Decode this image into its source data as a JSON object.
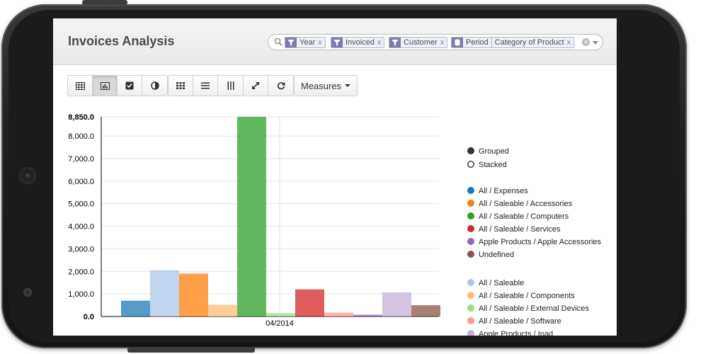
{
  "page": {
    "title": "Invoices Analysis"
  },
  "search": {
    "facets": [
      {
        "type": "filter",
        "label": "Year"
      },
      {
        "type": "filter",
        "label": "Invoiced"
      },
      {
        "type": "filter",
        "label": "Customer"
      },
      {
        "type": "groupby",
        "label": "Period",
        "value": "Category of Product"
      }
    ],
    "remove_label": "x"
  },
  "toolbar": {
    "measures_label": "Measures",
    "active_view": "chart"
  },
  "chart_data": {
    "type": "bar",
    "mode": "Grouped",
    "categories": [
      "04/2014"
    ],
    "ylim": [
      0,
      8850
    ],
    "y_ticks": [
      "0.0",
      "1,000.0",
      "2,000.0",
      "3,000.0",
      "4,000.0",
      "5,000.0",
      "6,000.0",
      "7,000.0",
      "8,000.0",
      "8,850.0"
    ],
    "y_tick_values": [
      0,
      1000,
      2000,
      3000,
      4000,
      5000,
      6000,
      7000,
      8000,
      8850
    ],
    "grid": true,
    "legend_position": "right",
    "mode_options": [
      {
        "label": "Grouped",
        "selected": true
      },
      {
        "label": "Stacked",
        "selected": false
      }
    ],
    "series": [
      {
        "name": "All / Expenses",
        "color": "#1f77b4",
        "values": [
          700
        ]
      },
      {
        "name": "All / Saleable",
        "color": "#aec7e8",
        "values": [
          2050
        ]
      },
      {
        "name": "All / Saleable / Accessories",
        "color": "#ff7f0e",
        "values": [
          1900
        ]
      },
      {
        "name": "All / Saleable / Components",
        "color": "#ffbb78",
        "values": [
          520
        ]
      },
      {
        "name": "All / Saleable / Computers",
        "color": "#2ca02c",
        "values": [
          8850
        ]
      },
      {
        "name": "All / Saleable / External Devices",
        "color": "#98df8a",
        "values": [
          150
        ]
      },
      {
        "name": "All / Saleable / Services",
        "color": "#d62728",
        "values": [
          1200
        ]
      },
      {
        "name": "All / Saleable / Software",
        "color": "#ff9896",
        "values": [
          170
        ]
      },
      {
        "name": "Apple Products / Apple Accessories",
        "color": "#9467bd",
        "values": [
          80
        ]
      },
      {
        "name": "Apple Products / Ipad",
        "color": "#c5b0d5",
        "values": [
          1070
        ]
      },
      {
        "name": "Undefined",
        "color": "#8c564b",
        "values": [
          500
        ]
      }
    ],
    "legend_groups": [
      [
        "All / Expenses",
        "All / Saleable / Accessories",
        "All / Saleable / Computers",
        "All / Saleable / Services",
        "Apple Products / Apple Accessories",
        "Undefined"
      ],
      [
        "All / Saleable",
        "All / Saleable / Components",
        "All / Saleable / External Devices",
        "All / Saleable / Software",
        "Apple Products / Ipad"
      ]
    ]
  }
}
